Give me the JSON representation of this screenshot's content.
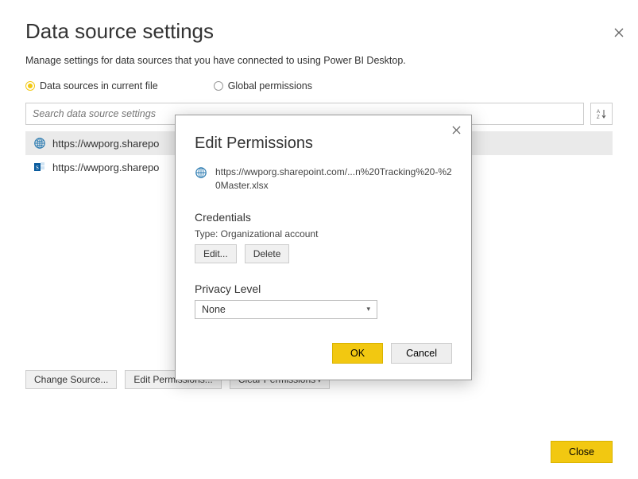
{
  "main": {
    "title": "Data source settings",
    "subtitle": "Manage settings for data sources that you have connected to using Power BI Desktop.",
    "radios": {
      "current": "Data sources in current file",
      "global": "Global permissions"
    },
    "search_placeholder": "Search data source settings",
    "items": [
      {
        "label": "https://wwporg.sharepo",
        "icon": "web"
      },
      {
        "label": "https://wwporg.sharepo",
        "icon": "sharepoint"
      }
    ],
    "buttons": {
      "change_source": "Change Source...",
      "edit_permissions": "Edit Permissions...",
      "clear_permissions": "Clear Permissions"
    },
    "close": "Close"
  },
  "modal": {
    "title": "Edit Permissions",
    "path": "https://wwporg.sharepoint.com/...n%20Tracking%20-%20Master.xlsx",
    "credentials_head": "Credentials",
    "type_line": "Type: Organizational account",
    "edit": "Edit...",
    "delete": "Delete",
    "privacy_head": "Privacy Level",
    "privacy_value": "None",
    "ok": "OK",
    "cancel": "Cancel"
  }
}
